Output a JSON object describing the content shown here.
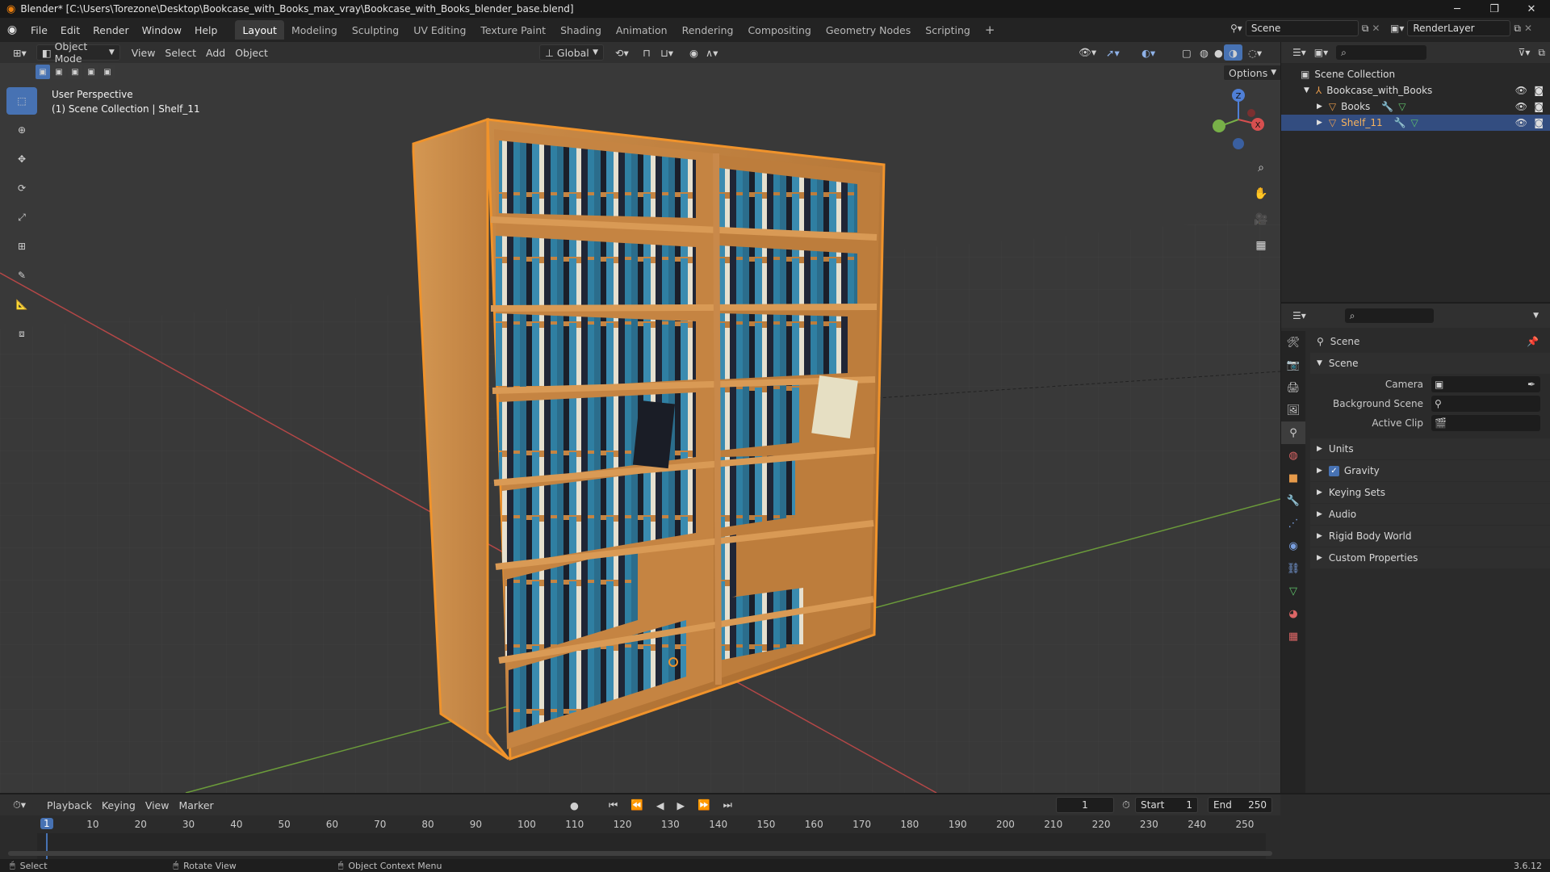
{
  "titlebar": {
    "title": "Blender* [C:\\Users\\Torezone\\Desktop\\Bookcase_with_Books_max_vray\\Bookcase_with_Books_blender_base.blend]",
    "minimize": "─",
    "maximize": "❐",
    "close": "✕"
  },
  "menu": [
    "File",
    "Edit",
    "Render",
    "Window",
    "Help"
  ],
  "workspaces": [
    "Layout",
    "Modeling",
    "Sculpting",
    "UV Editing",
    "Texture Paint",
    "Shading",
    "Animation",
    "Rendering",
    "Compositing",
    "Geometry Nodes",
    "Scripting"
  ],
  "active_workspace": "Layout",
  "add_workspace": "+",
  "scene_field": "Scene",
  "renderlayer_field": "RenderLayer",
  "viewport_header": {
    "mode": "Object Mode",
    "view": "View",
    "select": "Select",
    "add": "Add",
    "object": "Object",
    "orientation": "Global",
    "options": "Options"
  },
  "viewport_overlay": {
    "perspective": "User Perspective",
    "collection": "(1) Scene Collection | Shelf_11"
  },
  "gizmo": {
    "z": "Z",
    "x": "X"
  },
  "outliner": {
    "items": [
      {
        "label": "Scene Collection",
        "indent": 0,
        "selected": false
      },
      {
        "label": "Bookcase_with_Books",
        "indent": 1,
        "selected": false
      },
      {
        "label": "Books",
        "indent": 2,
        "selected": false
      },
      {
        "label": "Shelf_11",
        "indent": 2,
        "selected": true
      }
    ]
  },
  "properties": {
    "header": "Scene",
    "section": "Scene",
    "rows": [
      {
        "label": "Camera"
      },
      {
        "label": "Background Scene"
      },
      {
        "label": "Active Clip"
      }
    ],
    "panels": [
      "Units",
      "Gravity",
      "Keying Sets",
      "Audio",
      "Rigid Body World",
      "Custom Properties"
    ],
    "gravity_checked": true
  },
  "timeline": {
    "menus": [
      "Playback",
      "Keying",
      "View",
      "Marker"
    ],
    "current_frame": "1",
    "start_label": "Start",
    "start": "1",
    "end_label": "End",
    "end": "250",
    "ticks": [
      "1",
      "10",
      "20",
      "30",
      "40",
      "50",
      "60",
      "70",
      "80",
      "90",
      "100",
      "110",
      "120",
      "130",
      "140",
      "150",
      "160",
      "170",
      "180",
      "190",
      "200",
      "210",
      "220",
      "230",
      "240",
      "250"
    ]
  },
  "status": {
    "select": "Select",
    "rotate": "Rotate View",
    "context": "Object Context Menu",
    "version": "3.6.12"
  },
  "colors": {
    "accent": "#4772b3",
    "selection_outline": "#f0932b",
    "active_tab": "#3a3a3a",
    "grid_x": "#b44747",
    "grid_y": "#6b9b3a"
  }
}
